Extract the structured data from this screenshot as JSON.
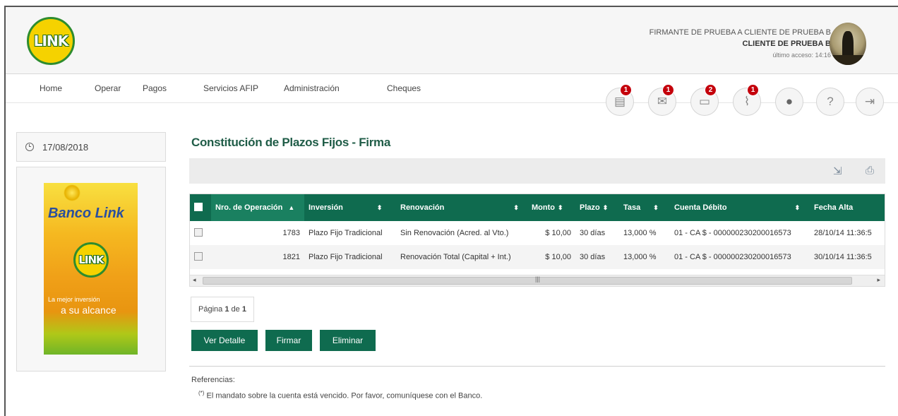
{
  "header": {
    "logo_text": "LINK",
    "user_line1": "FIRMANTE DE PRUEBA A CLIENTE DE PRUEBA B",
    "user_line2": "CLIENTE DE PRUEBA B",
    "user_line3": "último acceso: 14:16"
  },
  "nav": {
    "items": [
      "Home",
      "Operar",
      "Pagos",
      "Servicios AFIP",
      "Administración",
      "Cheques"
    ],
    "icons": [
      {
        "name": "document-icon",
        "glyph": "▤",
        "badge": "1"
      },
      {
        "name": "mail-icon",
        "glyph": "✉",
        "badge": "1"
      },
      {
        "name": "folder-icon",
        "glyph": "▭",
        "badge": "2"
      },
      {
        "name": "paperclip-icon",
        "glyph": "⌇",
        "badge": "1"
      },
      {
        "name": "user-icon",
        "glyph": "●",
        "badge": ""
      },
      {
        "name": "help-icon",
        "glyph": "?",
        "badge": ""
      },
      {
        "name": "logout-icon",
        "glyph": "⇥",
        "badge": ""
      }
    ]
  },
  "sidebar": {
    "date": "17/08/2018",
    "ad": {
      "title": "Banco Link",
      "logo_text": "LINK",
      "tagline1": "La mejor inversión",
      "tagline2": "a su alcance"
    }
  },
  "main": {
    "title": "Constitución de Plazos Fijos - Firma",
    "table": {
      "columns": [
        "Nro. de Operación",
        "Inversión",
        "Renovación",
        "Monto",
        "Plazo",
        "Tasa",
        "Cuenta Débito",
        "Fecha Alta"
      ],
      "rows": [
        {
          "nro": "1783",
          "inversion": "Plazo Fijo Tradicional",
          "renovacion": "Sin Renovación (Acred. al Vto.)",
          "monto": "$ 10,00",
          "plazo": "30 días",
          "tasa": "13,000 %",
          "cuenta": "01 - CA $ - 000000230200016573",
          "fecha": "28/10/14 11:36:5"
        },
        {
          "nro": "1821",
          "inversion": "Plazo Fijo Tradicional",
          "renovacion": "Renovación Total (Capital + Int.)",
          "monto": "$ 10,00",
          "plazo": "30 días",
          "tasa": "13,000 %",
          "cuenta": "01 - CA $ - 000000230200016573",
          "fecha": "30/10/14 11:36:5"
        }
      ]
    },
    "pager": {
      "prefix": "Página",
      "current": "1",
      "sep": "de",
      "total": "1"
    },
    "buttons": {
      "detail": "Ver Detalle",
      "sign": "Firmar",
      "delete": "Eliminar"
    },
    "references": {
      "label": "Referencias:",
      "mark": "(*)",
      "text": "El mandato sobre la cuenta está vencido. Por favor, comuníquese con el Banco."
    }
  },
  "colors": {
    "primary": "#0f6b4f",
    "badge": "#c4000b",
    "title": "#1f5c47"
  }
}
